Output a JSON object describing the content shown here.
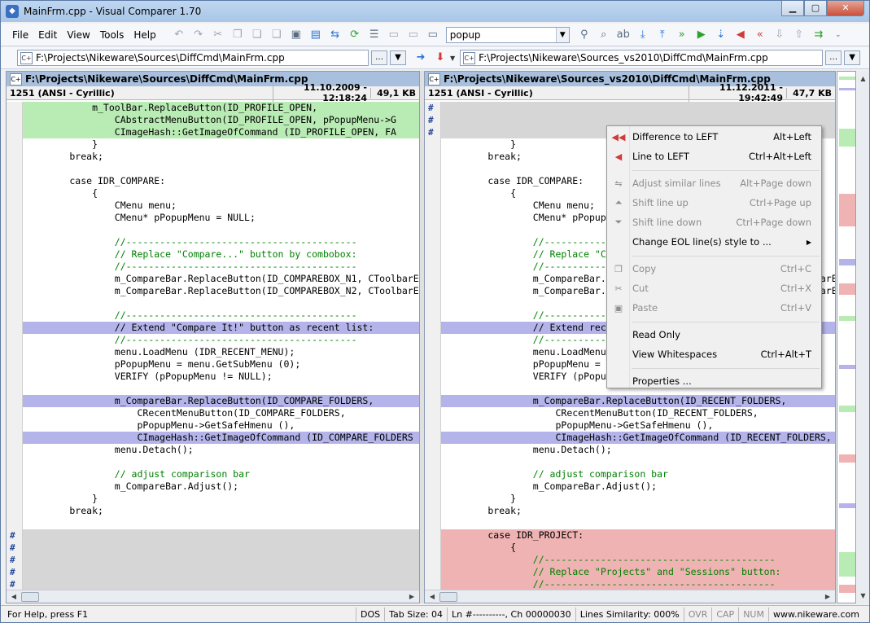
{
  "window": {
    "title": "MainFrm.cpp - Visual Comparer 1.70",
    "app_icon": "diff-icon"
  },
  "menu": [
    "File",
    "Edit",
    "View",
    "Tools",
    "Help"
  ],
  "toolbar": {
    "search_value": "popup"
  },
  "left": {
    "path": "F:\\Projects\\Nikeware\\Sources\\DiffCmd\\MainFrm.cpp",
    "header": "F:\\Projects\\Nikeware\\Sources\\DiffCmd\\MainFrm.cpp",
    "encoding": "1251 (ANSI - Cyrillic)",
    "date": "11.10.2009 - 12:18:24",
    "size": "49,1 KB",
    "lines": [
      {
        "t": "            m_ToolBar.ReplaceButton(ID_PROFILE_OPEN,",
        "bg": "green"
      },
      {
        "t": "                CAbstractMenuButton(ID_PROFILE_OPEN, pPopupMenu->G",
        "bg": "green"
      },
      {
        "t": "                CImageHash::GetImageOfCommand (ID_PROFILE_OPEN, FA",
        "bg": "green"
      },
      {
        "t": "            }",
        "bg": ""
      },
      {
        "t": "        break;",
        "bg": ""
      },
      {
        "t": "",
        "bg": ""
      },
      {
        "t": "        case IDR_COMPARE:",
        "bg": ""
      },
      {
        "t": "            {",
        "bg": ""
      },
      {
        "t": "                CMenu menu;",
        "bg": ""
      },
      {
        "t": "                CMenu* pPopupMenu = NULL;",
        "bg": ""
      },
      {
        "t": "",
        "bg": ""
      },
      {
        "t": "                //-----------------------------------------",
        "bg": "",
        "c": "cm"
      },
      {
        "t": "                // Replace \"Compare...\" button by combobox:",
        "bg": "",
        "c": "cm"
      },
      {
        "t": "                //-----------------------------------------",
        "bg": "",
        "c": "cm"
      },
      {
        "t": "                m_CompareBar.ReplaceButton(ID_COMPAREBOX_N1, CToolbarE",
        "bg": ""
      },
      {
        "t": "                m_CompareBar.ReplaceButton(ID_COMPAREBOX_N2, CToolbarE",
        "bg": ""
      },
      {
        "t": "",
        "bg": ""
      },
      {
        "t": "                //-----------------------------------------",
        "bg": "",
        "c": "cm"
      },
      {
        "t": "                // Extend \"Compare It!\" button as recent list:",
        "bg": "blue"
      },
      {
        "t": "                //-----------------------------------------",
        "bg": "",
        "c": "cm"
      },
      {
        "t": "                menu.LoadMenu (IDR_RECENT_MENU);",
        "bg": ""
      },
      {
        "t": "                pPopupMenu = menu.GetSubMenu (0);",
        "bg": ""
      },
      {
        "t": "                VERIFY (pPopupMenu != NULL);",
        "bg": ""
      },
      {
        "t": "",
        "bg": ""
      },
      {
        "t": "                m_CompareBar.ReplaceButton(ID_COMPARE_FOLDERS,",
        "bg": "blue"
      },
      {
        "t": "                    CRecentMenuButton(ID_COMPARE_FOLDERS,",
        "bg": ""
      },
      {
        "t": "                    pPopupMenu->GetSafeHmenu (),",
        "bg": ""
      },
      {
        "t": "                    CImageHash::GetImageOfCommand (ID_COMPARE_FOLDERS",
        "bg": "blue"
      },
      {
        "t": "                menu.Detach();",
        "bg": ""
      },
      {
        "t": "",
        "bg": ""
      },
      {
        "t": "                // adjust comparison bar",
        "bg": "",
        "c": "cm"
      },
      {
        "t": "                m_CompareBar.Adjust();",
        "bg": ""
      },
      {
        "t": "            }",
        "bg": ""
      },
      {
        "t": "        break;",
        "bg": ""
      },
      {
        "t": "",
        "bg": ""
      },
      {
        "t": "",
        "bg": "gray",
        "m": "#"
      },
      {
        "t": "",
        "bg": "gray",
        "m": "#"
      },
      {
        "t": "",
        "bg": "gray",
        "m": "#"
      },
      {
        "t": "",
        "bg": "gray",
        "m": "#"
      },
      {
        "t": "",
        "bg": "gray",
        "m": "#"
      }
    ]
  },
  "right": {
    "path": "F:\\Projects\\Nikeware\\Sources_vs2010\\DiffCmd\\MainFrm.cpp",
    "header": "F:\\Projects\\Nikeware\\Sources_vs2010\\DiffCmd\\MainFrm.cpp",
    "encoding": "1251 (ANSI - Cyrillic)",
    "date": "11.12.2011 - 19:42:49",
    "size": "47,7 KB",
    "lines": [
      {
        "t": "",
        "bg": "gray",
        "m": "#"
      },
      {
        "t": "",
        "bg": "gray",
        "m": "#"
      },
      {
        "t": "",
        "bg": "gray",
        "m": "#"
      },
      {
        "t": "            }",
        "bg": ""
      },
      {
        "t": "        break;",
        "bg": ""
      },
      {
        "t": "",
        "bg": ""
      },
      {
        "t": "        case IDR_COMPARE:",
        "bg": ""
      },
      {
        "t": "            {",
        "bg": ""
      },
      {
        "t": "                CMenu menu;",
        "bg": ""
      },
      {
        "t": "                CMenu* pPopupMenu = NULL;",
        "bg": ""
      },
      {
        "t": "",
        "bg": ""
      },
      {
        "t": "                //-----------------------------------------",
        "bg": "",
        "c": "cm"
      },
      {
        "t": "                // Replace \"Compare...\" button by combobox:",
        "bg": "",
        "c": "cm"
      },
      {
        "t": "                //-----------------------------------------",
        "bg": "",
        "c": "cm"
      },
      {
        "t": "                m_CompareBar.ReplaceButton(ID_COMPAREBOX_N1, CToolbarE",
        "bg": ""
      },
      {
        "t": "                m_CompareBar.ReplaceButton(ID_COMPAREBOX_N2, CToolbarE",
        "bg": ""
      },
      {
        "t": "",
        "bg": ""
      },
      {
        "t": "                //-----------------------------------------",
        "bg": "",
        "c": "cm"
      },
      {
        "t": "                // Extend recent list",
        "bg": "blue"
      },
      {
        "t": "                //-----------------------------------------",
        "bg": "",
        "c": "cm"
      },
      {
        "t": "                menu.LoadMenu (IDR_RECENT_MENU);",
        "bg": ""
      },
      {
        "t": "                pPopupMenu = menu.GetSubMenu (0);",
        "bg": ""
      },
      {
        "t": "                VERIFY (pPopupMenu != NULL);",
        "bg": ""
      },
      {
        "t": "",
        "bg": ""
      },
      {
        "t": "                m_CompareBar.ReplaceButton(ID_RECENT_FOLDERS,",
        "bg": "blue"
      },
      {
        "t": "                    CRecentMenuButton(ID_RECENT_FOLDERS,",
        "bg": ""
      },
      {
        "t": "                    pPopupMenu->GetSafeHmenu (),",
        "bg": ""
      },
      {
        "t": "                    CImageHash::GetImageOfCommand (ID_RECENT_FOLDERS,",
        "bg": "blue"
      },
      {
        "t": "                menu.Detach();",
        "bg": ""
      },
      {
        "t": "",
        "bg": ""
      },
      {
        "t": "                // adjust comparison bar",
        "bg": "",
        "c": "cm"
      },
      {
        "t": "                m_CompareBar.Adjust();",
        "bg": ""
      },
      {
        "t": "            }",
        "bg": ""
      },
      {
        "t": "        break;",
        "bg": ""
      },
      {
        "t": "",
        "bg": ""
      },
      {
        "t": "        case IDR_PROJECT:",
        "bg": "red"
      },
      {
        "t": "            {",
        "bg": "red"
      },
      {
        "t": "                //-----------------------------------------",
        "bg": "red",
        "c": "cm"
      },
      {
        "t": "                // Replace \"Projects\" and \"Sessions\" button:",
        "bg": "red",
        "c": "cm"
      },
      {
        "t": "                //-----------------------------------------",
        "bg": "red",
        "c": "cm"
      }
    ]
  },
  "context_menu": [
    {
      "label": "Difference to LEFT",
      "shortcut": "Alt+Left",
      "icon": "double-left-arrow-icon",
      "enabled": true
    },
    {
      "label": "Line to LEFT",
      "shortcut": "Ctrl+Alt+Left",
      "icon": "left-arrow-icon",
      "enabled": true
    },
    {
      "sep": true
    },
    {
      "label": "Adjust similar lines",
      "shortcut": "Alt+Page down",
      "icon": "adjust-icon",
      "enabled": false
    },
    {
      "label": "Shift line up",
      "shortcut": "Ctrl+Page up",
      "icon": "shift-up-icon",
      "enabled": false
    },
    {
      "label": "Shift line down",
      "shortcut": "Ctrl+Page down",
      "icon": "shift-down-icon",
      "enabled": false
    },
    {
      "label": "Change EOL line(s) style to ...",
      "shortcut": "",
      "icon": "",
      "enabled": true,
      "submenu": true
    },
    {
      "sep": true
    },
    {
      "label": "Copy",
      "shortcut": "Ctrl+C",
      "icon": "copy-icon",
      "enabled": false
    },
    {
      "label": "Cut",
      "shortcut": "Ctrl+X",
      "icon": "cut-icon",
      "enabled": false
    },
    {
      "label": "Paste",
      "shortcut": "Ctrl+V",
      "icon": "paste-icon",
      "enabled": false
    },
    {
      "sep": true
    },
    {
      "label": "Read Only",
      "shortcut": "",
      "icon": "",
      "enabled": true
    },
    {
      "label": "View Whitespaces",
      "shortcut": "Ctrl+Alt+T",
      "icon": "",
      "enabled": true
    },
    {
      "sep": true
    },
    {
      "label": "Properties ...",
      "shortcut": "",
      "icon": "",
      "enabled": true
    }
  ],
  "status": {
    "help": "For Help, press F1",
    "eol": "DOS",
    "tab": "Tab Size: 04",
    "pos": "Ln #----------, Ch 00000030",
    "similarity": "Lines Similarity: 000%",
    "ovr": "OVR",
    "cap": "CAP",
    "num": "NUM",
    "site": "www.nikeware.com"
  },
  "colors": {
    "added": "#b9ebb4",
    "changed": "#b4b4ea",
    "removed": "#f0b3b3",
    "missing": "#d6d6d6",
    "header": "#a8c0de"
  }
}
